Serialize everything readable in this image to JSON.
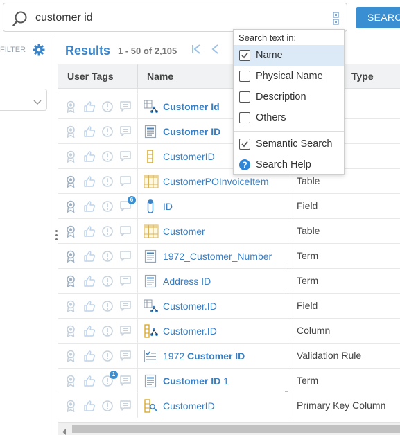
{
  "search": {
    "query": "customer id",
    "button_label": "SEARCH"
  },
  "left": {
    "filter_label": "FILTER"
  },
  "results": {
    "title": "Results",
    "count": "1 - 50 of 2,105"
  },
  "columns": {
    "tags": "User Tags",
    "name": "Name",
    "type": "Type"
  },
  "rows": [
    {
      "icon": "partial-row-icon",
      "name_pre": "",
      "name_bold": "",
      "name_post": "",
      "type": "",
      "tag_badge": ""
    },
    {
      "icon": "graph-node-icon",
      "name_pre": "",
      "name_bold": "Customer Id",
      "name_post": "",
      "type": "",
      "tag_badge": ""
    },
    {
      "icon": "document-icon",
      "name_pre": "",
      "name_bold": "Customer ID",
      "name_post": "",
      "type": "",
      "tag_badge": ""
    },
    {
      "icon": "column-icon",
      "name_pre": "CustomerID",
      "name_bold": "",
      "name_post": "",
      "type": "",
      "tag_badge": ""
    },
    {
      "icon": "table-icon",
      "name_pre": "CustomerPOInvoiceItem",
      "name_bold": "",
      "name_post": "",
      "type": "Table",
      "tag_badge": ""
    },
    {
      "icon": "field-icon",
      "name_pre": "ID",
      "name_bold": "",
      "name_post": "",
      "type": "Field",
      "tag_badge": "6"
    },
    {
      "icon": "table-icon",
      "name_pre": "Customer",
      "name_bold": "",
      "name_post": "",
      "type": "Table",
      "tag_badge": ""
    },
    {
      "icon": "document-icon",
      "name_pre": "1972_Customer_Number",
      "name_bold": "",
      "name_post": "",
      "type": "Term",
      "tag_badge": ""
    },
    {
      "icon": "document-icon",
      "name_pre": "Address ID",
      "name_bold": "",
      "name_post": "",
      "type": "Term",
      "tag_badge": ""
    },
    {
      "icon": "graph-node-icon",
      "name_pre": "Customer.ID",
      "name_bold": "",
      "name_post": "",
      "type": "Field",
      "tag_badge": ""
    },
    {
      "icon": "column-link-icon",
      "name_pre": "Customer.ID",
      "name_bold": "",
      "name_post": "",
      "type": "Column",
      "tag_badge": ""
    },
    {
      "icon": "validation-icon",
      "name_pre": "1972 ",
      "name_bold": "Customer ID",
      "name_post": "",
      "type": "Validation Rule",
      "tag_badge": ""
    },
    {
      "icon": "document-icon",
      "name_pre": "",
      "name_bold": "Customer ID",
      "name_post": " 1",
      "type": "Term",
      "tag_badge": "1"
    },
    {
      "icon": "primary-key-icon",
      "name_pre": "CustomerID",
      "name_bold": "",
      "name_post": "",
      "type": "Primary Key Column",
      "tag_badge": ""
    }
  ],
  "dropdown": {
    "header": "Search text in:",
    "options": [
      {
        "label": "Name",
        "checked": true
      },
      {
        "label": "Physical Name",
        "checked": false
      },
      {
        "label": "Description",
        "checked": false
      },
      {
        "label": "Others",
        "checked": false
      }
    ],
    "semantic": {
      "label": "Semantic Search",
      "checked": true
    },
    "help": {
      "label": "Search Help"
    }
  },
  "colors": {
    "accent": "#3a8fd2",
    "link": "#3a7fc2",
    "selected": "#dce9f6"
  }
}
